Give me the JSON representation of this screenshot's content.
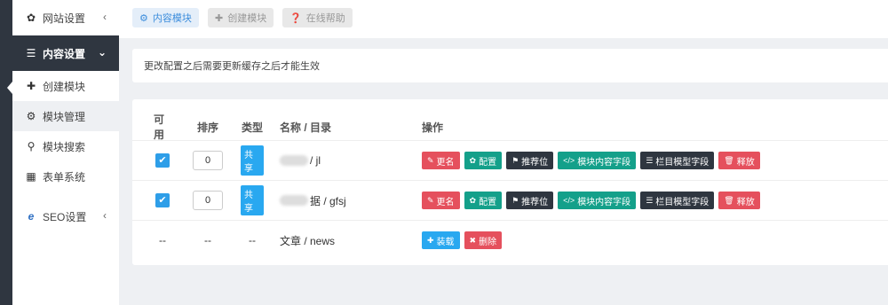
{
  "sidebar": {
    "items": [
      {
        "label": "网站设置",
        "icon": "gear-icon",
        "chevron": "‹"
      },
      {
        "label": "内容设置",
        "icon": "list-icon",
        "chevron": "⌄"
      },
      {
        "label": "创建模块",
        "icon": "plus-icon"
      },
      {
        "label": "模块管理",
        "icon": "cogs-icon"
      },
      {
        "label": "模块搜索",
        "icon": "search-icon"
      },
      {
        "label": "表单系统",
        "icon": "table-icon"
      },
      {
        "label": "SEO设置",
        "icon": "ie-icon",
        "chevron": "‹"
      }
    ]
  },
  "toolbar": {
    "content_module": "内容模块",
    "create_module": "创建模块",
    "online_help": "在线帮助"
  },
  "notice": "更改配置之后需要更新缓存之后才能生效",
  "table": {
    "headers": [
      "可用",
      "排序",
      "类型",
      "名称 / 目录",
      "操作"
    ],
    "rows": [
      {
        "sort": "0",
        "type": "共享",
        "name": "/ jl",
        "ops": [
          "更名",
          "配置",
          "推荐位",
          "模块内容字段",
          "栏目模型字段",
          "释放"
        ]
      },
      {
        "sort": "0",
        "type": "共享",
        "name": "据 / gfsj",
        "ops": [
          "更名",
          "配置",
          "推荐位",
          "模块内容字段",
          "栏目模型字段",
          "释放"
        ]
      },
      {
        "enabled": "--",
        "sort": "--",
        "type": "--",
        "name": "文章 / news",
        "ops": [
          "装载",
          "删除"
        ]
      }
    ]
  },
  "colors": {
    "accent": "#2e9ee8",
    "danger": "#e5505d",
    "success": "#14a08a",
    "dark": "#2f3640"
  }
}
